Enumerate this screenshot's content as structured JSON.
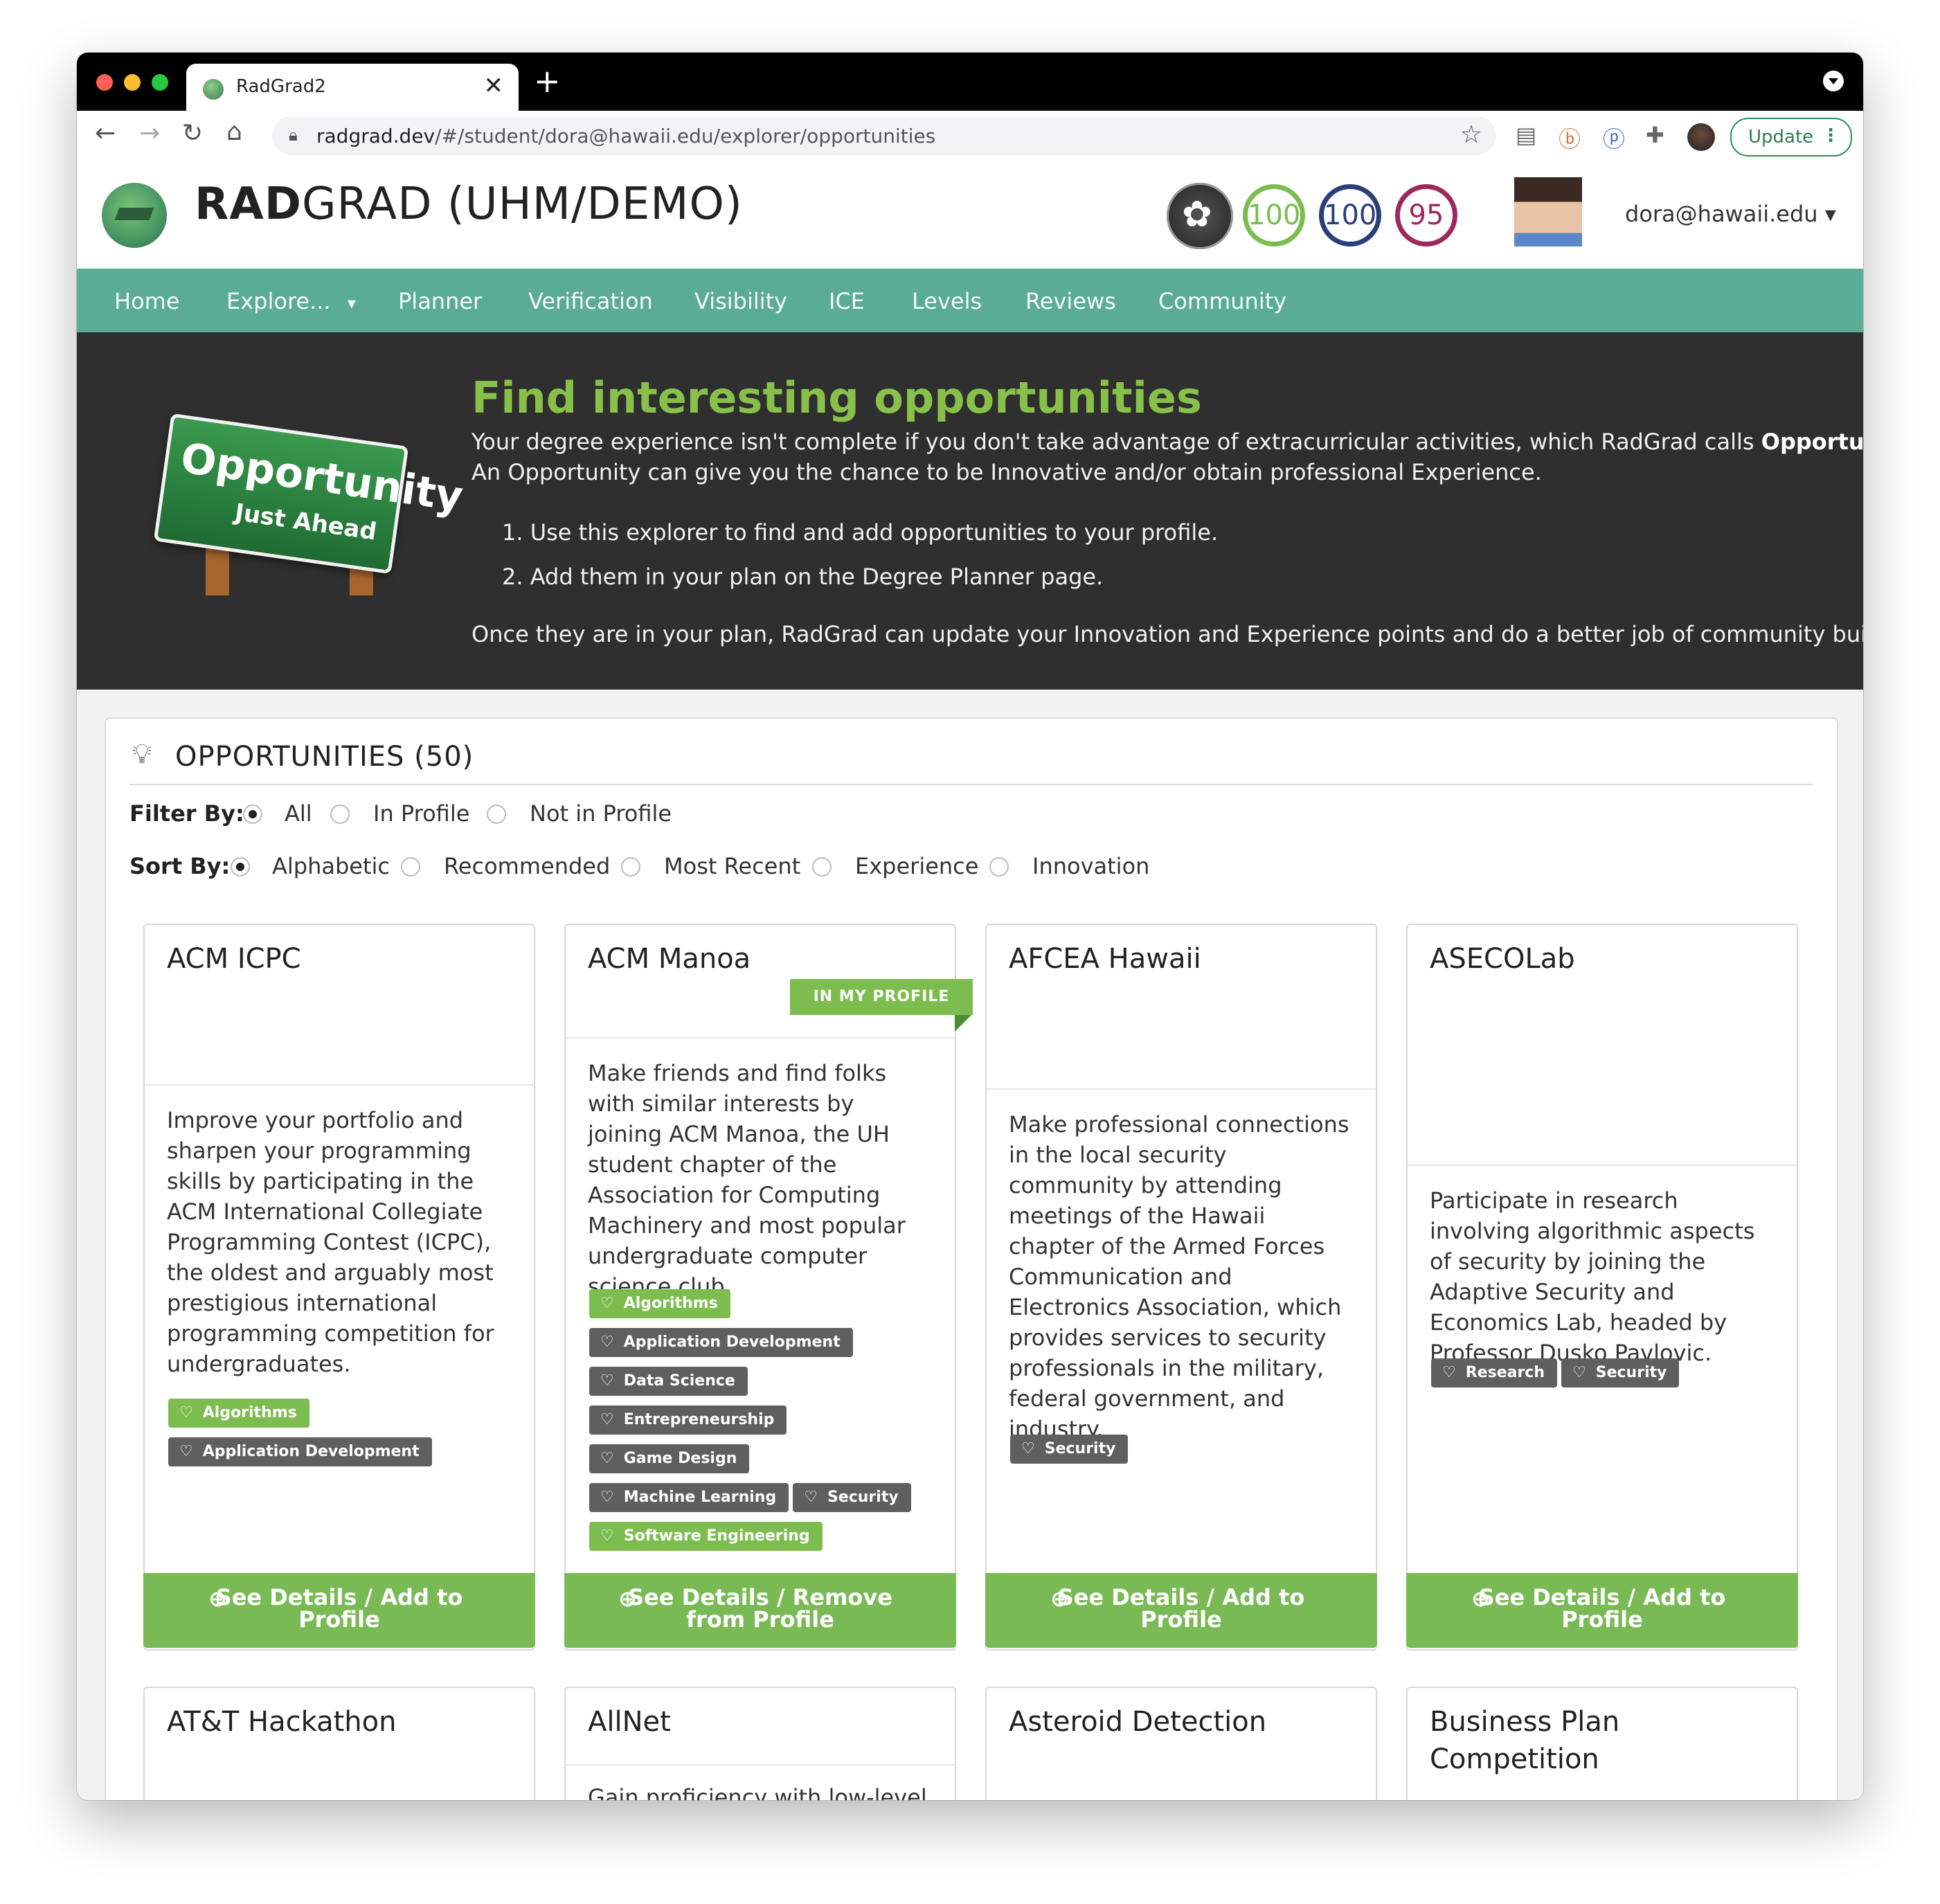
{
  "browser": {
    "tab_title": "RadGrad2",
    "tab_close": "✕",
    "new_tab": "+",
    "url_host": "radgrad.dev",
    "url_path": "/#/student/dora@hawaii.edu/explorer/opportunities",
    "update_label": "Update",
    "menu_dots": "⋮"
  },
  "header": {
    "brand_bold": "RAD",
    "brand_rest": "GRAD (UHM/DEMO)",
    "levels": [
      {
        "value": "100",
        "color": "#7cbd4f"
      },
      {
        "value": "100",
        "color": "#2a3f7a"
      },
      {
        "value": "95",
        "color": "#9b2a5c"
      }
    ],
    "user_email": "dora@hawaii.edu",
    "user_caret": "▾"
  },
  "nav": {
    "items": [
      "Home",
      "Explore...",
      "Planner",
      "Verification",
      "Visibility",
      "ICE",
      "Levels",
      "Reviews",
      "Community"
    ],
    "explore_caret": "▾"
  },
  "hero": {
    "sign_line1": "Opportunity",
    "sign_line2": "Just Ahead",
    "title": "Find interesting opportunities",
    "para1_a": "Your degree experience isn't complete if you don't take advantage of extracurricular activities, which RadGrad calls ",
    "para1_bold": "Opportunities",
    "para1_b": ".",
    "para2": "An Opportunity can give you the chance to be Innovative and/or obtain professional Experience.",
    "step1": "1. Use this explorer to find and add opportunities to your profile.",
    "step2": "2. Add them in your plan on the Degree Planner page.",
    "para3": "Once they are in your plan, RadGrad can update your Innovation and Experience points and do a better job of community building."
  },
  "opportunities": {
    "title": "OPPORTUNITIES (50)",
    "filter_label": "Filter By:",
    "filter_options": [
      "All",
      "In Profile",
      "Not in Profile"
    ],
    "filter_selected": "All",
    "sort_label": "Sort By:",
    "sort_options": [
      "Alphabetic",
      "Recommended",
      "Most Recent",
      "Experience",
      "Innovation"
    ],
    "sort_selected": "Alphabetic",
    "cards": [
      {
        "name": "ACM ICPC",
        "description": "Improve your portfolio and sharpen your programming skills by participating in the ACM International Collegiate Programming Contest (ICPC), the oldest and arguably most prestigious international programming competition for undergraduates.",
        "tags": [
          {
            "label": "Algorithms",
            "highlight": true
          },
          {
            "label": "Application Development",
            "highlight": false
          }
        ],
        "button_line1": "See Details / Add to",
        "button_line2": "Profile"
      },
      {
        "name": "ACM Manoa",
        "ribbon": "IN MY PROFILE",
        "description": "Make friends and find folks with similar interests by joining ACM Manoa, the UH student chapter of the Association for Computing Machinery and most popular undergraduate computer science club.",
        "tags": [
          {
            "label": "Algorithms",
            "highlight": true
          },
          {
            "label": "Application Development",
            "highlight": false
          },
          {
            "label": "Data Science",
            "highlight": false
          },
          {
            "label": "Entrepreneurship",
            "highlight": false
          },
          {
            "label": "Game Design",
            "highlight": false
          },
          {
            "label": "Machine Learning",
            "highlight": false
          },
          {
            "label": "Security",
            "highlight": false
          },
          {
            "label": "Software Engineering",
            "highlight": true
          }
        ],
        "button_line1": "See Details / Remove",
        "button_line2": "from Profile"
      },
      {
        "name": "AFCEA Hawaii",
        "description": "Make professional connections in the local security community by attending meetings of the Hawaii chapter of the Armed Forces Communication and Electronics Association, which provides services to security professionals in the military, federal government, and industry.",
        "tags": [
          {
            "label": "Security",
            "highlight": false
          }
        ],
        "button_line1": "See Details / Add to",
        "button_line2": "Profile"
      },
      {
        "name": "ASECOLab",
        "description": "Participate in research involving algorithmic aspects of security by joining the Adaptive Security and Economics Lab, headed by Professor Dusko Pavlovic.",
        "tags": [
          {
            "label": "Research",
            "highlight": false
          },
          {
            "label": "Security",
            "highlight": false
          }
        ],
        "button_line1": "See Details / Add to",
        "button_line2": "Profile"
      }
    ],
    "second_row": [
      {
        "name": "AT&T Hackathon"
      },
      {
        "name": "AllNet",
        "description": "Gain proficiency with low-level"
      },
      {
        "name": "Asteroid Detection"
      },
      {
        "name": "Business Plan Competition"
      }
    ]
  },
  "icons": {
    "back": "arrow-left-icon",
    "forward": "arrow-right-icon",
    "reload": "reload-icon",
    "home": "home-icon",
    "lock": "lock-icon",
    "star": "star-icon",
    "bulb": "lightbulb-icon",
    "heart": "heart-icon",
    "magnifier": "zoom-in-icon"
  }
}
